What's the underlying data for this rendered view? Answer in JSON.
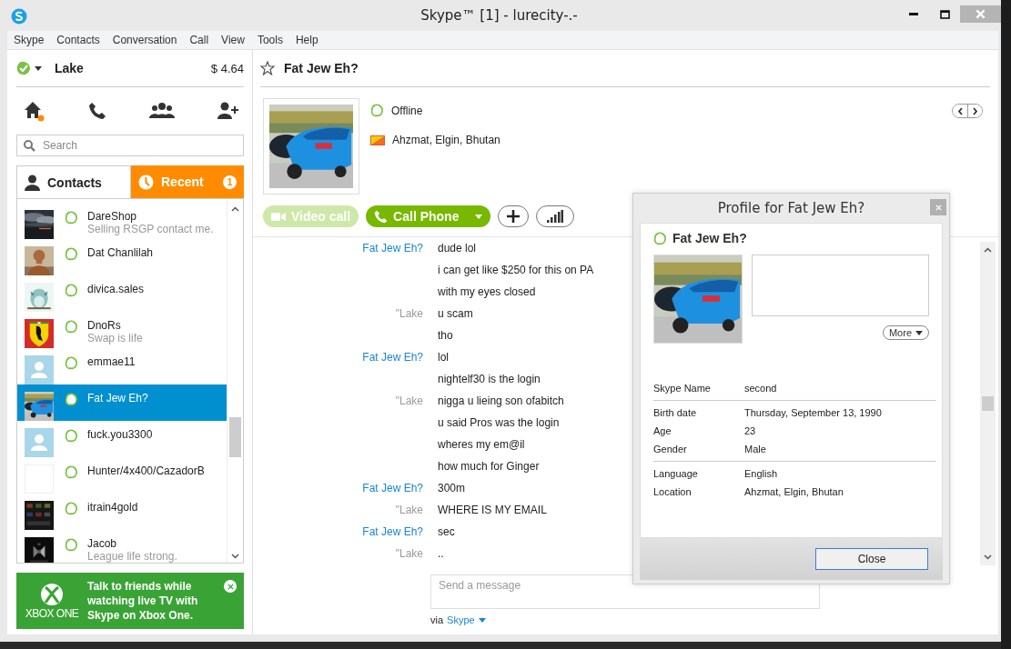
{
  "window": {
    "title": "Skype™ [1] - lurecity-.-"
  },
  "menu": [
    "Skype",
    "Contacts",
    "Conversation",
    "Call",
    "View",
    "Tools",
    "Help"
  ],
  "account": {
    "name": "Lake",
    "credit": "$ 4.64"
  },
  "search": {
    "placeholder": "Search"
  },
  "tabs": [
    {
      "label": "Contacts",
      "selected": true
    },
    {
      "label": "Recent",
      "selected": false,
      "badge": "1"
    }
  ],
  "contacts": [
    {
      "name": "DareShop",
      "mood": "Selling RSGP contact me.",
      "kind": "picture",
      "selected": false
    },
    {
      "name": "Dat Chanlilah",
      "kind": "picture",
      "selected": false
    },
    {
      "name": "divica.sales",
      "kind": "picture",
      "selected": false
    },
    {
      "name": "DnoRs",
      "mood": "Swap is life",
      "kind": "picture",
      "selected": false
    },
    {
      "name": "emmae11",
      "kind": "default",
      "selected": false
    },
    {
      "name": "Fat Jew Eh?",
      "kind": "picture",
      "selected": true
    },
    {
      "name": "fuck.you3300",
      "kind": "default",
      "selected": false
    },
    {
      "name": "Hunter/4x400/CazadorB",
      "kind": "blank",
      "selected": false
    },
    {
      "name": "itrain4gold",
      "kind": "picture",
      "selected": false
    },
    {
      "name": "Jacob",
      "mood": "League life strong.",
      "kind": "picture",
      "selected": false
    }
  ],
  "ad": {
    "logo": "XBOX ONE",
    "text": "Talk to friends while watching live TV with Skype on Xbox One."
  },
  "conversation": {
    "title": "Fat Jew Eh?",
    "status": "Offline",
    "location": "Ahzmat, Elgin, Bhutan"
  },
  "call_buttons": [
    {
      "label": "Video call",
      "kind": "video",
      "disabled": true
    },
    {
      "label": "Call Phone",
      "kind": "phone",
      "disabled": false
    }
  ],
  "messages": [
    {
      "sender": "Fat Jew Eh?",
      "kind": "them",
      "text": "dude lol"
    },
    {
      "kind": "them",
      "text": "i can get like $250 for this on PA"
    },
    {
      "kind": "them",
      "text": "with my eyes closed"
    },
    {
      "sender": "\"Lake",
      "kind": "me",
      "text": "u scam"
    },
    {
      "kind": "me",
      "text": "tho"
    },
    {
      "sender": "Fat Jew Eh?",
      "kind": "them",
      "text": "lol"
    },
    {
      "kind": "them",
      "text": "nightelf30 is the login"
    },
    {
      "sender": "\"Lake",
      "kind": "me",
      "text": "nigga u lieing son ofabitch"
    },
    {
      "kind": "me",
      "text": "u said Pros was the login"
    },
    {
      "kind": "me",
      "text": "wheres my em@il"
    },
    {
      "kind": "me",
      "text": "how much for Ginger"
    },
    {
      "sender": "Fat Jew Eh?",
      "kind": "them",
      "text": "300m"
    },
    {
      "sender": "\"Lake",
      "kind": "me",
      "text": "WHERE IS MY EMAIL"
    },
    {
      "sender": "Fat Jew Eh?",
      "kind": "them",
      "text": "sec"
    },
    {
      "sender": "\"Lake",
      "kind": "me",
      "text": ".."
    }
  ],
  "composer": {
    "placeholder": "Send a message",
    "via": "via",
    "service": "Skype"
  },
  "profile": {
    "title": "Profile for Fat Jew Eh?",
    "name": "Fat Jew Eh?",
    "more": "More",
    "field_groups": [
      [
        {
          "label": "Skype Name",
          "value": "second"
        }
      ],
      [
        {
          "label": "Birth date",
          "value": "Thursday, September 13, 1990"
        },
        {
          "label": "Age",
          "value": "23"
        },
        {
          "label": "Gender",
          "value": "Male"
        }
      ],
      [
        {
          "label": "Language",
          "value": "English"
        },
        {
          "label": "Location",
          "value": "Ahzmat, Elgin, Bhutan"
        }
      ]
    ],
    "close": "Close"
  }
}
